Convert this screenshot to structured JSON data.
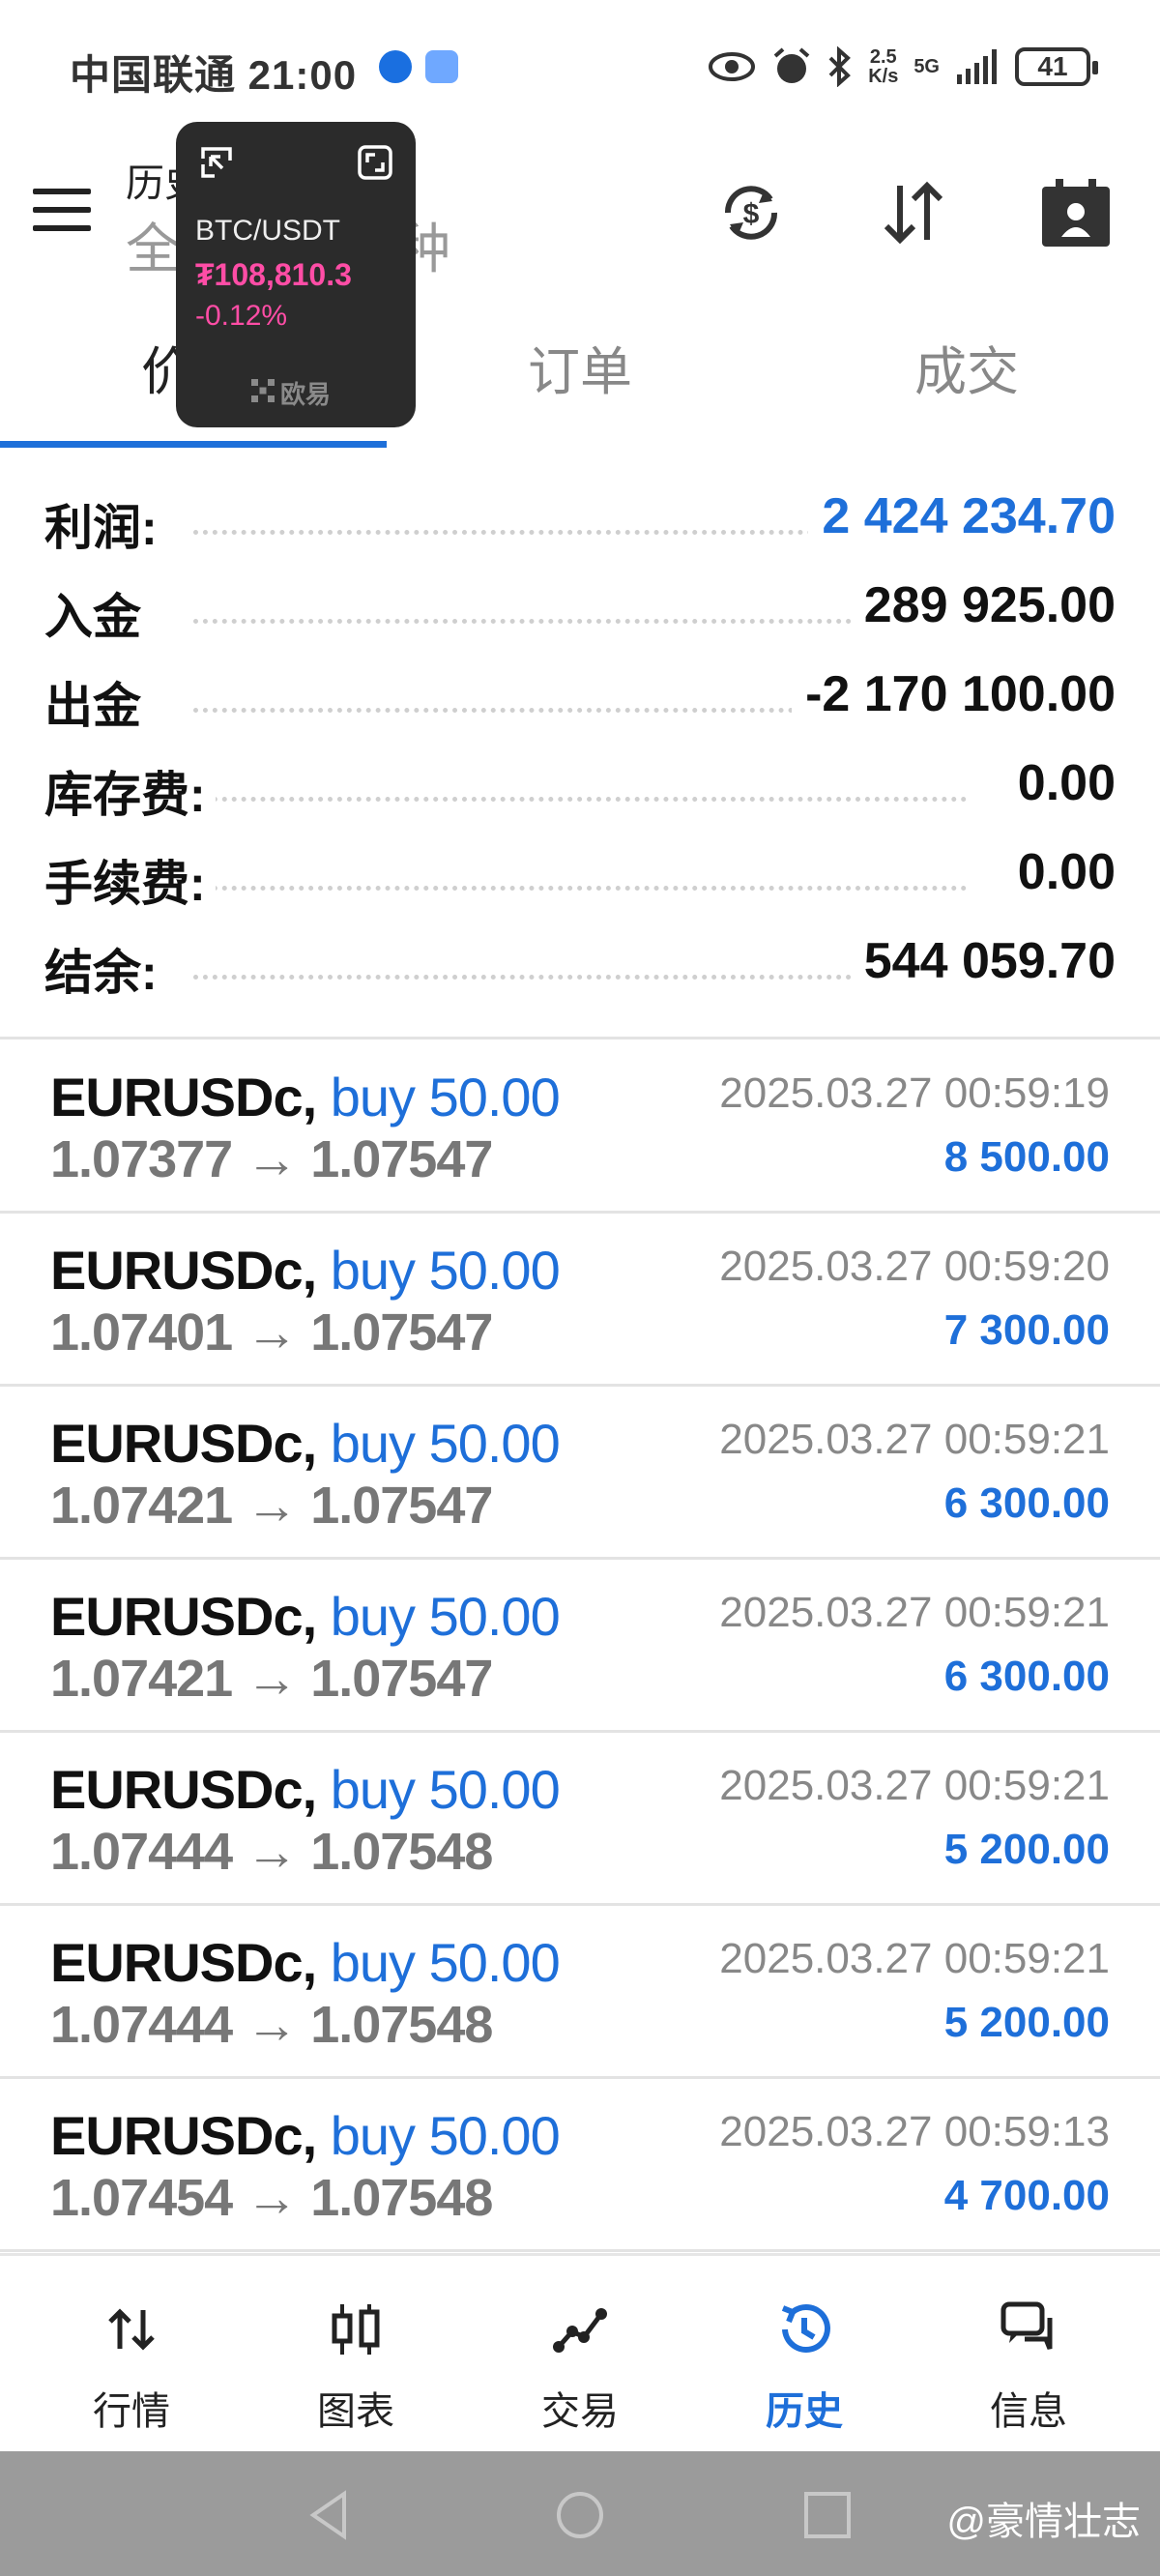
{
  "status_bar": {
    "carrier_time": "中国联通 21:00",
    "net_speed_value": "2.5",
    "net_speed_unit": "K/s",
    "network": "5G",
    "battery": "41"
  },
  "header": {
    "title": "历史",
    "subtitle": "全部交易品种"
  },
  "tabs": [
    {
      "label": "价格",
      "active": true
    },
    {
      "label": "订单",
      "active": false
    },
    {
      "label": "成交",
      "active": false
    }
  ],
  "overlay": {
    "pair": "BTC/USDT",
    "price": "₮108,810.3",
    "change": "-0.12%",
    "brand": "欧易"
  },
  "summary": [
    {
      "label": "利润:",
      "value": "2 424 234.70",
      "highlight": true
    },
    {
      "label": "入金",
      "value": "289 925.00",
      "highlight": false
    },
    {
      "label": "出金",
      "value": "-2 170 100.00",
      "highlight": false
    },
    {
      "label": "库存费:",
      "value": "0.00",
      "highlight": false
    },
    {
      "label": "手续费:",
      "value": "0.00",
      "highlight": false
    },
    {
      "label": "结余:",
      "value": "544 059.70",
      "highlight": false
    }
  ],
  "trades": [
    {
      "symbol": "EURUSDc,",
      "side": "buy 50.00",
      "prices": "1.07377 → 1.07547",
      "time": "2025.03.27 00:59:19",
      "profit": "8 500.00"
    },
    {
      "symbol": "EURUSDc,",
      "side": "buy 50.00",
      "prices": "1.07401 → 1.07547",
      "time": "2025.03.27 00:59:20",
      "profit": "7 300.00"
    },
    {
      "symbol": "EURUSDc,",
      "side": "buy 50.00",
      "prices": "1.07421 → 1.07547",
      "time": "2025.03.27 00:59:21",
      "profit": "6 300.00"
    },
    {
      "symbol": "EURUSDc,",
      "side": "buy 50.00",
      "prices": "1.07421 → 1.07547",
      "time": "2025.03.27 00:59:21",
      "profit": "6 300.00"
    },
    {
      "symbol": "EURUSDc,",
      "side": "buy 50.00",
      "prices": "1.07444 → 1.07548",
      "time": "2025.03.27 00:59:21",
      "profit": "5 200.00"
    },
    {
      "symbol": "EURUSDc,",
      "side": "buy 50.00",
      "prices": "1.07444 → 1.07548",
      "time": "2025.03.27 00:59:21",
      "profit": "5 200.00"
    },
    {
      "symbol": "EURUSDc,",
      "side": "buy 50.00",
      "prices": "1.07454 → 1.07548",
      "time": "2025.03.27 00:59:13",
      "profit": "4 700.00"
    }
  ],
  "bottom_nav": [
    {
      "label": "行情",
      "icon": "quotes-arrows-icon",
      "active": false
    },
    {
      "label": "图表",
      "icon": "candlestick-chart-icon",
      "active": false
    },
    {
      "label": "交易",
      "icon": "trade-line-icon",
      "active": false
    },
    {
      "label": "历史",
      "icon": "history-clock-icon",
      "active": true
    },
    {
      "label": "信息",
      "icon": "messages-icon",
      "active": false
    }
  ],
  "watermark": "@豪情壮志",
  "colors": {
    "accent": "#1e6fd9",
    "overlay_price": "#ff4da6",
    "overlay_bg": "#2b2b2b"
  }
}
